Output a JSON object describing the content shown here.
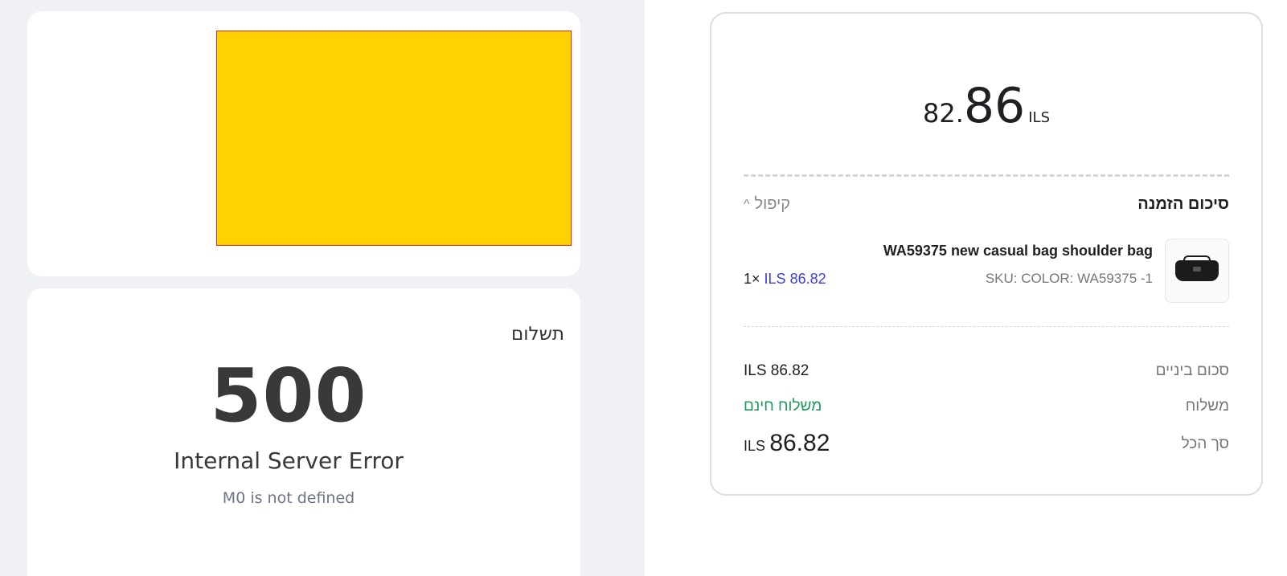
{
  "payment": {
    "title": "תשלום",
    "error_code": "500",
    "error_title": "Internal Server Error",
    "error_message": "M0 is not defined"
  },
  "summary": {
    "hero_total": {
      "decimal": "82.",
      "integer": "86",
      "currency": "ILS"
    },
    "title": "סיכום הזמנה",
    "collapse_label": "קיפול",
    "item": {
      "name": "WA59375 new casual bag shoulder bag",
      "sku": "SKU: COLOR: WA59375 -1",
      "quantity": "1×",
      "price": "ILS 86.82"
    },
    "subtotal_label": "סכום ביניים",
    "subtotal_value": "ILS 86.82",
    "shipping_label": "משלוח",
    "shipping_value": "משלוח חינם",
    "total_label": "סך הכל",
    "total_currency": "ILS",
    "total_value": "86.82"
  },
  "colors": {
    "accent_price": "#3b3fd8",
    "free_shipping": "#1f9a5d",
    "placeholder_fill": "#ffd100",
    "placeholder_border": "#e8282a"
  }
}
